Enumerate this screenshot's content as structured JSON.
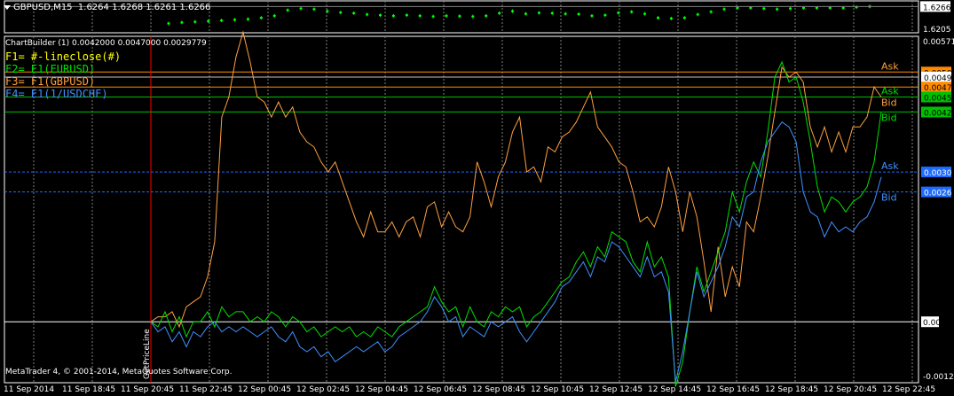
{
  "upper_panel": {
    "symbol": "GBPUSD,M15",
    "ohlc": "1.6264 1.6268 1.6261 1.6266",
    "current_price": "1.6266",
    "low_label": "1.6205"
  },
  "lower_panel": {
    "title": "ChartBuilder (1) 0.0042000 0.0047000 0.0029779",
    "axis_top": "0.005715",
    "axis_zero": "0.00",
    "axis_bottom": "-0.00122",
    "price_line_label": "GetPriceLine",
    "legend": [
      {
        "label": "F1= #-lineclose(#)",
        "color": "#ffff00"
      },
      {
        "label": "F2= E1(EURUSD)",
        "color": "#00e000"
      },
      {
        "label": "F3= F1(GBPUSD)",
        "color": "#ffa040"
      },
      {
        "label": "F4= E1(1/USDCHF)",
        "color": "#4090ff"
      }
    ],
    "price_tags": [
      {
        "text": "0.0050",
        "y": 0.005,
        "bg": "#ff8c00",
        "fg": "#000000"
      },
      {
        "text": "0.0049",
        "y": 0.0049,
        "bg": "#ffffff",
        "fg": "#000000"
      },
      {
        "text": "0.0047",
        "y": 0.0047,
        "bg": "#ff8c00",
        "fg": "#000000"
      },
      {
        "text": "0.0045",
        "y": 0.0045,
        "bg": "#00c000",
        "fg": "#000000"
      },
      {
        "text": "0.0042",
        "y": 0.0042,
        "bg": "#00c000",
        "fg": "#000000"
      },
      {
        "text": "0.0030",
        "y": 0.003,
        "bg": "#1e6cff",
        "fg": "#ffffff"
      },
      {
        "text": "0.0026",
        "y": 0.0026,
        "bg": "#1e6cff",
        "fg": "#ffffff"
      }
    ],
    "level_labels": [
      {
        "text": "Ask",
        "y": 0.005,
        "color": "#ffa040"
      },
      {
        "text": "Ask",
        "y": 0.0045,
        "color": "#00e000"
      },
      {
        "text": "Bid",
        "y": 0.0045,
        "color": "#ffa040"
      },
      {
        "text": "Bid",
        "y": 0.0042,
        "color": "#00e000"
      },
      {
        "text": "Ask",
        "y": 0.003,
        "color": "#4090ff"
      },
      {
        "text": "Bid",
        "y": 0.0026,
        "color": "#4090ff"
      }
    ]
  },
  "copyright": "MetaTrader 4, © 2001-2014, MetaQuotes Software Corp.",
  "colors": {
    "background": "#000000",
    "grid": "#808080",
    "axis_text": "#ffffff",
    "candle": "#00ff00",
    "f3_line": "#ffa040",
    "f2_line": "#00e000",
    "f4_line": "#4090ff",
    "price_line": "#ff0000"
  },
  "chart_data": [
    {
      "type": "line",
      "title": "GBPUSD,M15 1.6264 1.6268 1.6261 1.6266",
      "note_price_range": [
        1.6195,
        1.6275
      ],
      "series": [
        {
          "name": "GBPUSD close",
          "values": [
            1.6215,
            1.6218,
            1.622,
            1.6222,
            1.6224,
            1.6226,
            1.6228,
            1.6232,
            1.6238,
            1.6255,
            1.626,
            1.6258,
            1.6252,
            1.6248,
            1.6246,
            1.6242,
            1.624,
            1.6238,
            1.624,
            1.6238,
            1.6236,
            1.6238,
            1.6237,
            1.6236,
            1.6238,
            1.6246,
            1.6252,
            1.6244,
            1.6247,
            1.6246,
            1.6244,
            1.6243,
            1.6238,
            1.624,
            1.6247,
            1.625,
            1.6244,
            1.6232,
            1.623,
            1.6232,
            1.6242,
            1.625,
            1.6258,
            1.6262,
            1.6262,
            1.626,
            1.6258,
            1.626,
            1.6262,
            1.6262,
            1.6262,
            1.6262,
            1.6264,
            1.6266
          ]
        }
      ]
    },
    {
      "type": "line",
      "title": "ChartBuilder (1) 0.0042000 0.0047000 0.0029779",
      "x_ticks": [
        "11 Sep 2014",
        "11 Sep 18:45",
        "11 Sep 20:45",
        "11 Sep 22:45",
        "12 Sep 00:45",
        "12 Sep 02:45",
        "12 Sep 04:45",
        "12 Sep 06:45",
        "12 Sep 08:45",
        "12 Sep 10:45",
        "12 Sep 12:45",
        "12 Sep 14:45",
        "12 Sep 16:45",
        "12 Sep 18:45",
        "12 Sep 20:45",
        "12 Sep 22:45"
      ],
      "ylim": [
        -0.00122,
        0.005715
      ],
      "series": [
        {
          "name": "F3= F1(GBPUSD)",
          "color": "#ffa040",
          "values": [
            0.0,
            0.0001,
            0.0001,
            0.0002,
            -0.0001,
            0.0003,
            0.0004,
            0.0005,
            0.0009,
            0.0016,
            0.0041,
            0.0045,
            0.0053,
            0.0058,
            0.0052,
            0.0045,
            0.0044,
            0.0041,
            0.0044,
            0.0041,
            0.0043,
            0.0038,
            0.0036,
            0.0035,
            0.0032,
            0.003,
            0.0032,
            0.0028,
            0.0024,
            0.002,
            0.0017,
            0.0022,
            0.0018,
            0.0018,
            0.002,
            0.0017,
            0.002,
            0.0021,
            0.0017,
            0.0023,
            0.0024,
            0.0019,
            0.0022,
            0.0019,
            0.0018,
            0.0021,
            0.0032,
            0.0028,
            0.0023,
            0.0029,
            0.0032,
            0.0038,
            0.0041,
            0.003,
            0.0031,
            0.0028,
            0.0035,
            0.0034,
            0.0037,
            0.0038,
            0.004,
            0.0043,
            0.0046,
            0.0039,
            0.0037,
            0.0035,
            0.0032,
            0.0031,
            0.0026,
            0.002,
            0.0021,
            0.0019,
            0.0023,
            0.0031,
            0.0026,
            0.0018,
            0.0026,
            0.0021,
            0.0012,
            0.0002,
            0.0015,
            0.0005,
            0.0011,
            0.0007,
            0.002,
            0.0018,
            0.0025,
            0.0033,
            0.0042,
            0.0051,
            0.0049,
            0.005,
            0.0048,
            0.0039,
            0.0035,
            0.0039,
            0.0034,
            0.0038,
            0.0034,
            0.0039,
            0.0039,
            0.0041,
            0.0047,
            0.0045
          ]
        },
        {
          "name": "F2= E1(EURUSD)",
          "color": "#00e000",
          "values": [
            0.0,
            -0.0001,
            0.0002,
            -0.0002,
            0.0001,
            -0.0003,
            0.0,
            0.0,
            0.0002,
            -0.0001,
            0.0003,
            0.0001,
            0.0002,
            0.0002,
            0.0,
            0.0001,
            0.0,
            0.0002,
            0.0001,
            -0.0001,
            0.0001,
            0.0,
            -0.0002,
            -0.0001,
            -0.0003,
            -0.0002,
            -0.0001,
            -0.0002,
            -0.0001,
            -0.0003,
            -0.0002,
            -0.0003,
            -0.0001,
            -0.0002,
            -0.0003,
            -0.0001,
            0.0,
            0.0001,
            0.0002,
            0.0003,
            0.0007,
            0.0004,
            0.0002,
            0.0003,
            -0.0001,
            0.0003,
            0.0,
            -0.0001,
            0.0002,
            0.0001,
            0.0003,
            0.0002,
            0.0003,
            -0.0001,
            0.0001,
            0.0002,
            0.0004,
            0.0006,
            0.0008,
            0.0009,
            0.0012,
            0.0014,
            0.0011,
            0.0015,
            0.0013,
            0.0018,
            0.0017,
            0.0016,
            0.0012,
            0.001,
            0.0016,
            0.0011,
            0.0013,
            0.0009,
            -0.0013,
            -0.0008,
            0.0002,
            0.0011,
            0.0006,
            0.001,
            0.0014,
            0.0018,
            0.0026,
            0.0022,
            0.0028,
            0.0032,
            0.0029,
            0.0038,
            0.0049,
            0.0052,
            0.0048,
            0.0049,
            0.0044,
            0.0036,
            0.0027,
            0.0022,
            0.0025,
            0.0024,
            0.0022,
            0.0024,
            0.0025,
            0.0027,
            0.0032,
            0.0042
          ]
        },
        {
          "name": "F4= E1(1/USDCHF)",
          "color": "#4090ff",
          "values": [
            0.0,
            -0.0002,
            -0.0001,
            -0.0004,
            -0.0002,
            -0.0005,
            -0.0002,
            -0.0003,
            -0.0001,
            0.0,
            -0.0002,
            -0.0001,
            -0.0002,
            -0.0001,
            -0.0002,
            -0.0003,
            -0.0002,
            -0.0001,
            -0.0003,
            -0.0004,
            -0.0002,
            -0.0005,
            -0.0006,
            -0.0005,
            -0.0007,
            -0.0006,
            -0.0008,
            -0.0007,
            -0.0006,
            -0.0005,
            -0.0006,
            -0.0005,
            -0.0004,
            -0.0006,
            -0.0005,
            -0.0003,
            -0.0002,
            -0.0001,
            0.0,
            0.0002,
            0.0005,
            0.0003,
            0.0,
            0.0001,
            -0.0003,
            -0.0001,
            -0.0002,
            -0.0003,
            0.0,
            -0.0001,
            0.0,
            0.0001,
            -0.0002,
            -0.0004,
            -0.0002,
            0.0,
            0.0002,
            0.0004,
            0.0007,
            0.0008,
            0.001,
            0.0012,
            0.0009,
            0.0013,
            0.0012,
            0.0016,
            0.0015,
            0.0013,
            0.0011,
            0.0009,
            0.0013,
            0.0009,
            0.001,
            0.0006,
            -0.0012,
            -0.0006,
            0.0002,
            0.001,
            0.0005,
            0.0008,
            0.0011,
            0.0015,
            0.0021,
            0.0019,
            0.0025,
            0.0026,
            0.0032,
            0.0036,
            0.0038,
            0.004,
            0.0039,
            0.0036,
            0.0026,
            0.0022,
            0.0021,
            0.0017,
            0.002,
            0.0018,
            0.0019,
            0.0018,
            0.002,
            0.0021,
            0.0024,
            0.0029
          ]
        }
      ]
    }
  ]
}
